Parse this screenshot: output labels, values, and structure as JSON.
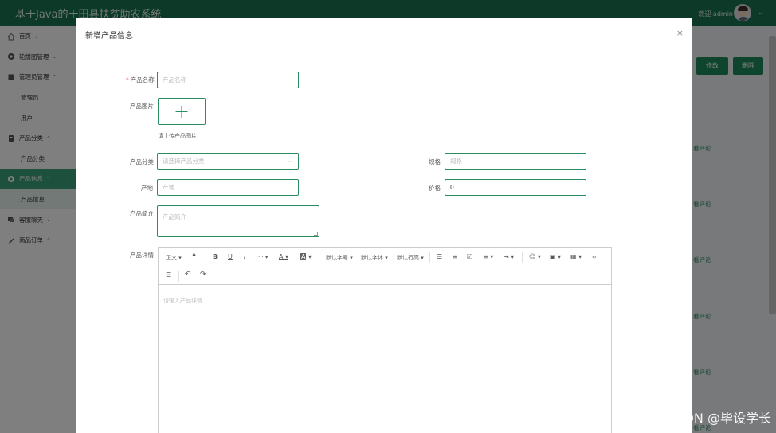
{
  "app": {
    "title": "基于Java的于田县扶贫助农系统",
    "welcome": "欢迎 admin"
  },
  "sidebar": {
    "items": [
      {
        "label": "首页",
        "arrow": "⌄"
      },
      {
        "label": "轮播图管理",
        "arrow": "⌄"
      },
      {
        "label": "管理员管理",
        "arrow": "⌃"
      },
      {
        "label": "管理员"
      },
      {
        "label": "用户"
      },
      {
        "label": "产品分类",
        "arrow": "⌃"
      },
      {
        "label": "产品分类"
      },
      {
        "label": "产品信息",
        "arrow": "⌃"
      },
      {
        "label": "产品信息"
      },
      {
        "label": "客服聊天",
        "arrow": "⌄"
      },
      {
        "label": "商品订单",
        "arrow": "⌃"
      }
    ]
  },
  "content": {
    "edit_button": "修改",
    "delete_button": "删除",
    "row_links": [
      "看评论",
      "看评论",
      "看评论",
      "看评论",
      "看评论",
      "看评论"
    ]
  },
  "modal": {
    "title": "新增产品信息",
    "close": "×",
    "fields": {
      "name": {
        "label": "产品名称",
        "required": "*",
        "placeholder": "产品名称"
      },
      "image": {
        "label": "产品图片",
        "tip": "请上传产品图片",
        "plus": "+"
      },
      "category": {
        "label": "产品分类",
        "placeholder": "请选择产品分类"
      },
      "spec": {
        "label": "规格",
        "placeholder": "规格"
      },
      "origin": {
        "label": "产地",
        "placeholder": "产地"
      },
      "price": {
        "label": "价格",
        "value": "0"
      },
      "intro": {
        "label": "产品简介",
        "placeholder": "产品简介"
      },
      "detail": {
        "label": "产品详情",
        "placeholder": "请输入产品详情"
      }
    },
    "toolbar": {
      "paragraph": "正文",
      "quote": "❝",
      "bold": "B",
      "underline": "U",
      "italic": "I",
      "more": "···",
      "font_color": "A",
      "bg_color": "A",
      "font_size": "默认字号",
      "font_family": "默认字体",
      "line_height": "默认行高",
      "bullet_list": "☰",
      "numbered_list": "≡",
      "todo": "☑",
      "align": "≡",
      "indent": "⇥",
      "emoji": "☺",
      "image": "▣",
      "table": "▦",
      "code": "‹›",
      "divider": "☰",
      "undo": "↶",
      "redo": "↷"
    }
  },
  "watermark": "CSDN @毕设学长",
  "colors": {
    "header": "#1a7252",
    "accent": "#2a8c61",
    "active_menu": "#3aa17a"
  }
}
